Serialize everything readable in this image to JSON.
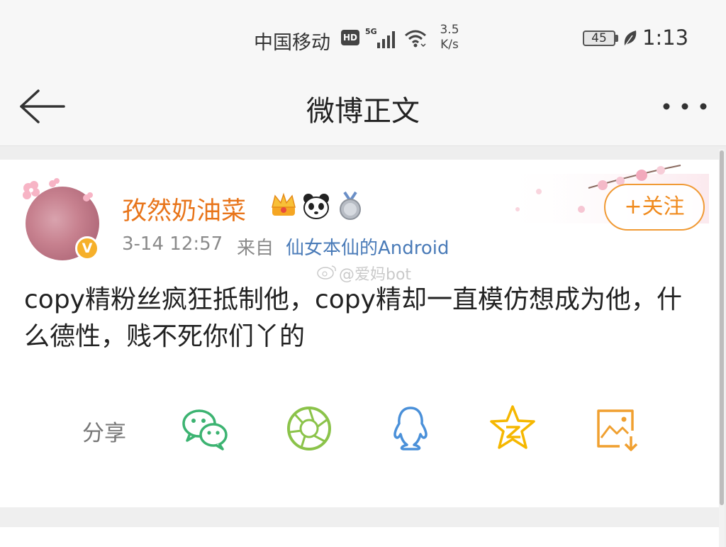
{
  "status_bar": {
    "carrier": "中国移动",
    "hd": "HD",
    "network": "5G",
    "speed_value": "3.5",
    "speed_unit": "K/s",
    "battery": "45",
    "time": "1:13"
  },
  "nav": {
    "title": "微博正文"
  },
  "post": {
    "username": "孜然奶油菜",
    "verified_badge": "V",
    "time": "3-14 12:57",
    "from_label": "来自",
    "source": "仙女本仙的Android",
    "follow_label": "+关注",
    "watermark": "@爱妈bot",
    "content": "copy精粉丝疯狂抵制他，copy精却一直模仿想成为他，什么德性，贱不死你们丫的"
  },
  "share": {
    "label": "分享",
    "targets": [
      "wechat-icon",
      "moments-icon",
      "qq-icon",
      "qzone-icon",
      "save-image-icon"
    ]
  },
  "colors": {
    "username": "#e8751b",
    "source_link": "#4a7bb8",
    "follow": "#f08a1d",
    "wechat": "#3cb371",
    "moments": "#8bc34a",
    "qq": "#4a90d9",
    "qzone": "#f5b700",
    "save": "#f0a030"
  }
}
